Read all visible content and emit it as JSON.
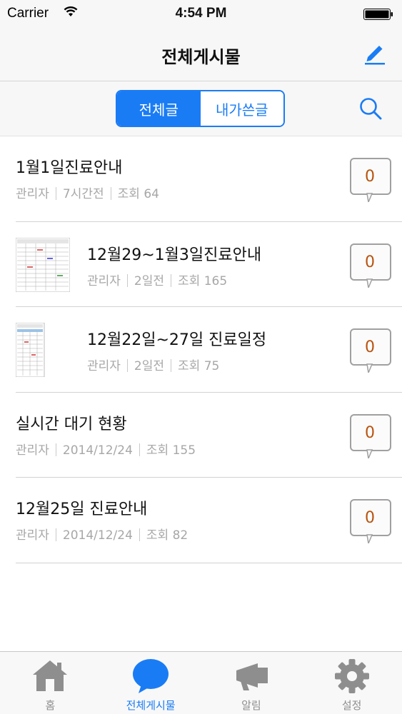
{
  "status_bar": {
    "carrier": "Carrier",
    "time": "4:54 PM"
  },
  "nav": {
    "title": "전체게시물",
    "compose_icon": "pencil-icon"
  },
  "segments": [
    {
      "label": "전체글",
      "active": true
    },
    {
      "label": "내가쓴글",
      "active": false
    }
  ],
  "search_icon": "magnifier-icon",
  "posts": [
    {
      "title": "1월1일진료안내",
      "author": "관리자",
      "date": "7시간전",
      "views": "조회 64",
      "comments": "0",
      "has_thumbnail": false
    },
    {
      "title": "12월29~1월3일진료안내",
      "author": "관리자",
      "date": "2일전",
      "views": "조회 165",
      "comments": "0",
      "has_thumbnail": true
    },
    {
      "title": "12월22일~27일 진료일정",
      "author": "관리자",
      "date": "2일전",
      "views": "조회 75",
      "comments": "0",
      "has_thumbnail": true
    },
    {
      "title": "실시간 대기 현황",
      "author": "관리자",
      "date": "2014/12/24",
      "views": "조회 155",
      "comments": "0",
      "has_thumbnail": false
    },
    {
      "title": "12월25일 진료안내",
      "author": "관리자",
      "date": "2014/12/24",
      "views": "조회 82",
      "comments": "0",
      "has_thumbnail": false
    }
  ],
  "tabs": [
    {
      "label": "홈",
      "icon": "home-icon",
      "active": false
    },
    {
      "label": "전체게시물",
      "icon": "speech-bubble-icon",
      "active": true
    },
    {
      "label": "알림",
      "icon": "megaphone-icon",
      "active": false
    },
    {
      "label": "설정",
      "icon": "gear-icon",
      "active": false
    }
  ],
  "colors": {
    "accent": "#1a7cf5",
    "comment_count": "#b8530f",
    "meta": "#a7a7a7"
  }
}
